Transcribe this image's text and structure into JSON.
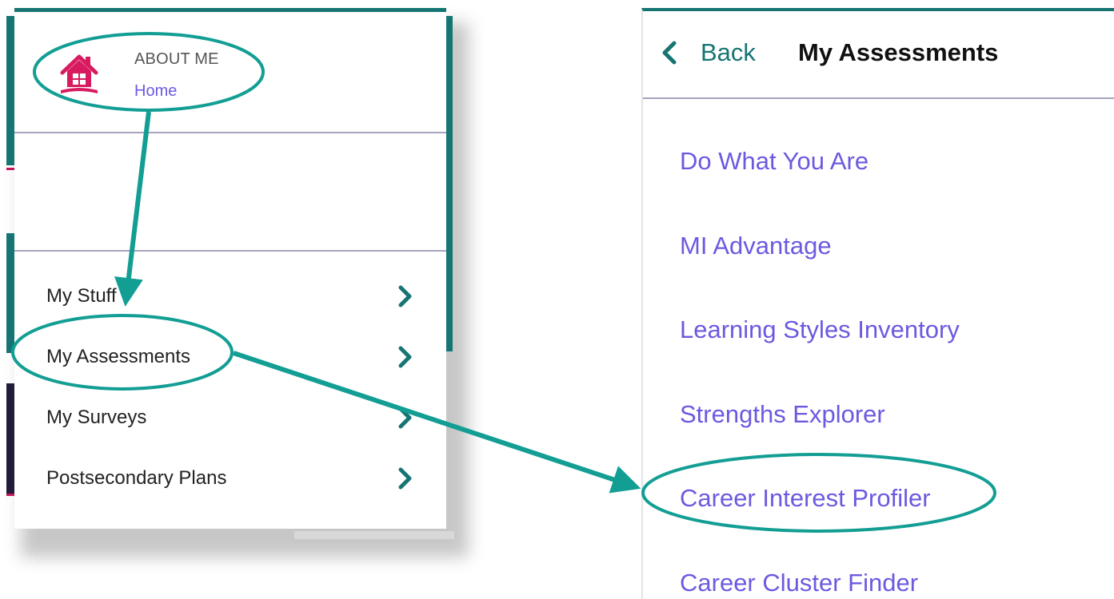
{
  "left_menu": {
    "section_title": "ABOUT ME",
    "home_link": "Home",
    "items": [
      {
        "label": "My Stuff"
      },
      {
        "label": "My Assessments"
      },
      {
        "label": "My Surveys"
      },
      {
        "label": "Postsecondary Plans"
      }
    ]
  },
  "right_panel": {
    "back_label": "Back",
    "title": "My Assessments",
    "items": [
      {
        "label": "Do What You Are"
      },
      {
        "label": "MI Advantage"
      },
      {
        "label": "Learning Styles Inventory"
      },
      {
        "label": "Strengths Explorer"
      },
      {
        "label": "Career Interest Profiler"
      },
      {
        "label": "Career Cluster Finder"
      }
    ]
  },
  "colors": {
    "teal": "#167572",
    "link_purple": "#6b5ae0",
    "home_icon_pink": "#d81b60",
    "annotation": "#139e94"
  },
  "icons": {
    "home": "house-icon",
    "chevron": "chevron-right-icon",
    "back": "chevron-left-icon"
  }
}
